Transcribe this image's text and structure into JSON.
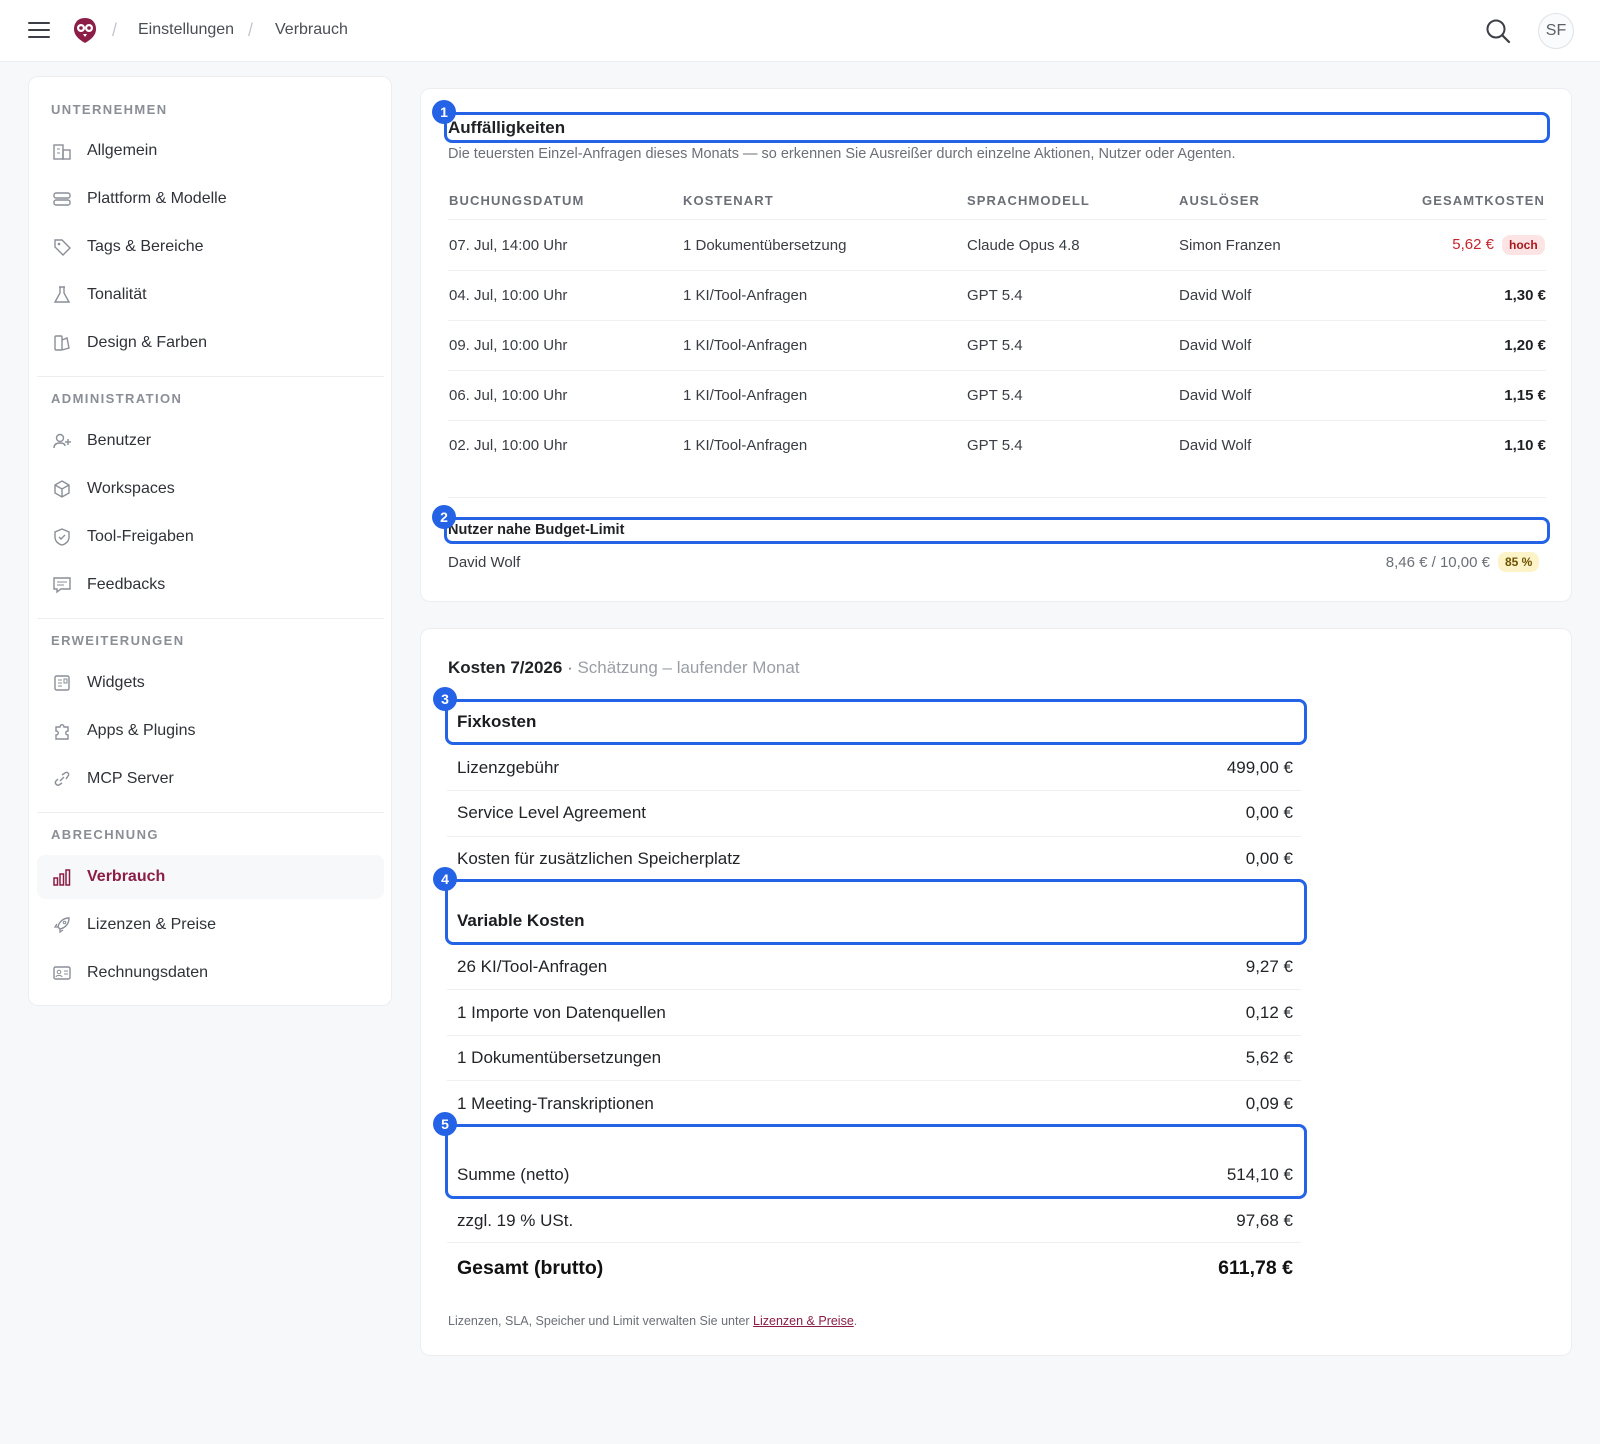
{
  "breadcrumb": {
    "items": [
      "Einstellungen",
      "Verbrauch"
    ]
  },
  "user": {
    "initials": "SF"
  },
  "sidebar": {
    "sections": [
      {
        "title": "UNTERNEHMEN",
        "items": [
          {
            "label": "Allgemein",
            "icon": "building-icon"
          },
          {
            "label": "Plattform & Modelle",
            "icon": "database-icon"
          },
          {
            "label": "Tags & Bereiche",
            "icon": "tag-icon"
          },
          {
            "label": "Tonalität",
            "icon": "flask-icon"
          },
          {
            "label": "Design & Farben",
            "icon": "palette-icon"
          }
        ]
      },
      {
        "title": "ADMINISTRATION",
        "items": [
          {
            "label": "Benutzer",
            "icon": "user-plus-icon"
          },
          {
            "label": "Workspaces",
            "icon": "cube-icon"
          },
          {
            "label": "Tool-Freigaben",
            "icon": "shield-check-icon"
          },
          {
            "label": "Feedbacks",
            "icon": "comment-icon"
          }
        ]
      },
      {
        "title": "ERWEITERUNGEN",
        "items": [
          {
            "label": "Widgets",
            "icon": "widget-icon"
          },
          {
            "label": "Apps & Plugins",
            "icon": "puzzle-icon"
          },
          {
            "label": "MCP Server",
            "icon": "link-icon"
          }
        ]
      },
      {
        "title": "ABRECHNUNG",
        "items": [
          {
            "label": "Verbrauch",
            "icon": "bar-chart-icon",
            "active": true
          },
          {
            "label": "Lizenzen & Preise",
            "icon": "rocket-icon"
          },
          {
            "label": "Rechnungsdaten",
            "icon": "id-card-icon"
          }
        ]
      }
    ]
  },
  "anomalies": {
    "marker": "1",
    "title": "Auffälligkeiten",
    "subtitle": "Die teuersten Einzel-Anfragen dieses Monats — so erkennen Sie Ausreißer durch einzelne Aktionen, Nutzer oder Agenten.",
    "columns": [
      "BUCHUNGSDATUM",
      "KOSTENART",
      "SPRACHMODELL",
      "AUSLÖSER",
      "GESAMTKOSTEN"
    ],
    "rows": [
      {
        "date": "07. Jul, 14:00 Uhr",
        "type": "1 Dokumentübersetzung",
        "model": "Claude Opus 4.8",
        "trigger": "Simon Franzen",
        "cost": "5,62 €",
        "badge": "hoch"
      },
      {
        "date": "04. Jul, 10:00 Uhr",
        "type": "1 KI/Tool-Anfragen",
        "model": "GPT 5.4",
        "trigger": "David Wolf",
        "cost": "1,30 €"
      },
      {
        "date": "09. Jul, 10:00 Uhr",
        "type": "1 KI/Tool-Anfragen",
        "model": "GPT 5.4",
        "trigger": "David Wolf",
        "cost": "1,20 €"
      },
      {
        "date": "06. Jul, 10:00 Uhr",
        "type": "1 KI/Tool-Anfragen",
        "model": "GPT 5.4",
        "trigger": "David Wolf",
        "cost": "1,15 €"
      },
      {
        "date": "02. Jul, 10:00 Uhr",
        "type": "1 KI/Tool-Anfragen",
        "model": "GPT 5.4",
        "trigger": "David Wolf",
        "cost": "1,10 €"
      }
    ],
    "accent_color": "#c8232c"
  },
  "budget": {
    "marker": "2",
    "title": "Nutzer nahe Budget-Limit",
    "user": "David Wolf",
    "usage": "8,46 € / 10,00 €",
    "percent": "85 %"
  },
  "costs": {
    "title": "Kosten 7/2026",
    "sep": " · ",
    "subtitle": "Schätzung – laufender Monat",
    "fixed": {
      "marker": "3",
      "title": "Fixkosten",
      "items": [
        {
          "label": "Lizenzgebühr",
          "value": "499,00 €"
        },
        {
          "label": "Service Level Agreement",
          "value": "0,00 €"
        },
        {
          "label": "Kosten für zusätzlichen Speicherplatz",
          "value": "0,00 €"
        }
      ]
    },
    "variable": {
      "marker": "4",
      "title": "Variable Kosten",
      "items": [
        {
          "label": "26 KI/Tool-Anfragen",
          "value": "9,27 €"
        },
        {
          "label": "1 Importe von Datenquellen",
          "value": "0,12 €"
        },
        {
          "label": "1 Dokumentübersetzungen",
          "value": "5,62 €"
        },
        {
          "label": "1 Meeting-Transkriptionen",
          "value": "0,09 €"
        }
      ]
    },
    "net": {
      "marker": "5",
      "label": "Summe (netto)",
      "value": "514,10 €"
    },
    "vat": {
      "label": "zzgl. 19 % USt.",
      "value": "97,68 €"
    },
    "gross": {
      "label": "Gesamt (brutto)",
      "value": "611,78 €"
    },
    "footnote_pre": "Lizenzen, SLA, Speicher und Limit verwalten Sie unter ",
    "footnote_link": "Lizenzen & Preise",
    "footnote_post": "."
  },
  "colors": {
    "brand": "#8c1d47",
    "highlight": "#2563e6"
  }
}
